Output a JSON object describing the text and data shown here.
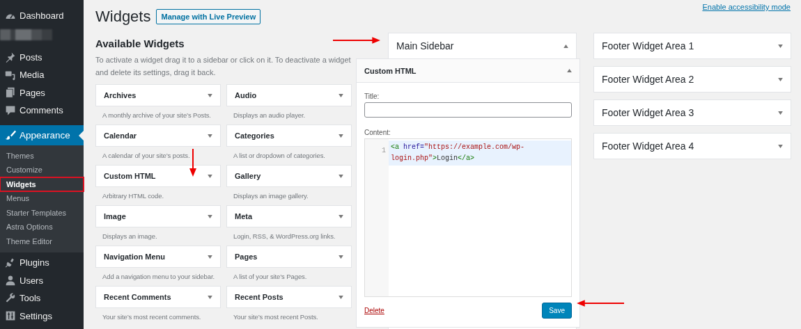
{
  "admin_menu": {
    "items": [
      {
        "kind": "menu",
        "label": "Dashboard",
        "selected": false
      },
      {
        "kind": "redacted"
      },
      {
        "kind": "menu",
        "label": "Posts",
        "selected": false
      },
      {
        "kind": "menu",
        "label": "Media",
        "selected": false
      },
      {
        "kind": "menu",
        "label": "Pages",
        "selected": false
      },
      {
        "kind": "menu",
        "label": "Comments",
        "selected": false
      },
      {
        "kind": "menu",
        "label": "Appearance",
        "selected": true,
        "expanded": true,
        "children": [
          {
            "label": "Themes",
            "selected": false,
            "highlighted": false
          },
          {
            "label": "Customize",
            "selected": false,
            "highlighted": false
          },
          {
            "label": "Widgets",
            "selected": true,
            "highlighted": true
          },
          {
            "label": "Menus",
            "selected": false,
            "highlighted": false
          },
          {
            "label": "Starter Templates",
            "selected": false,
            "highlighted": false
          },
          {
            "label": "Astra Options",
            "selected": false,
            "highlighted": false
          },
          {
            "label": "Theme Editor",
            "selected": false,
            "highlighted": false
          }
        ]
      },
      {
        "kind": "menu",
        "label": "Plugins",
        "selected": false
      },
      {
        "kind": "menu",
        "label": "Users",
        "selected": false
      },
      {
        "kind": "menu",
        "label": "Tools",
        "selected": false
      },
      {
        "kind": "menu",
        "label": "Settings",
        "selected": false
      }
    ]
  },
  "page": {
    "title": "Widgets",
    "live_preview_button": "Manage with Live Preview",
    "accessibility_link": "Enable accessibility mode"
  },
  "available_widgets": {
    "heading": "Available Widgets",
    "description": "To activate a widget drag it to a sidebar or click on it. To deactivate a widget and delete its settings, drag it back.",
    "items": [
      {
        "title": "Archives",
        "description": "A monthly archive of your site’s Posts."
      },
      {
        "title": "Audio",
        "description": "Displays an audio player."
      },
      {
        "title": "Calendar",
        "description": "A calendar of your site’s posts."
      },
      {
        "title": "Categories",
        "description": "A list or dropdown of categories."
      },
      {
        "title": "Custom HTML",
        "description": "Arbitrary HTML code."
      },
      {
        "title": "Gallery",
        "description": "Displays an image gallery."
      },
      {
        "title": "Image",
        "description": "Displays an image."
      },
      {
        "title": "Meta",
        "description": "Login, RSS, & WordPress.org links."
      },
      {
        "title": "Navigation Menu",
        "description": "Add a navigation menu to your sidebar."
      },
      {
        "title": "Pages",
        "description": "A list of your site’s Pages."
      },
      {
        "title": "Recent Comments",
        "description": "Your site’s most recent comments."
      },
      {
        "title": "Recent Posts",
        "description": "Your site’s most recent Posts."
      }
    ]
  },
  "main_sidebar": {
    "title": "Main Sidebar",
    "expanded": true,
    "widget": {
      "title": "Custom HTML",
      "expanded": true,
      "title_label": "Title:",
      "content_label": "Content:",
      "code": {
        "line_number": "1",
        "tokens": [
          {
            "kind": "tag",
            "text": "<a"
          },
          {
            "kind": "attr",
            "text": " href="
          },
          {
            "kind": "string",
            "text": "\"https://example.com/wp-login.php\""
          },
          {
            "kind": "tag",
            "text": ">"
          },
          {
            "kind": "text",
            "text": "Login"
          },
          {
            "kind": "tag",
            "text": "</a>"
          }
        ]
      },
      "delete_link": "Delete",
      "save_button": "Save"
    }
  },
  "footer_areas": [
    {
      "title": "Footer Widget Area 1",
      "expanded": false
    },
    {
      "title": "Footer Widget Area 2",
      "expanded": false
    },
    {
      "title": "Footer Widget Area 3",
      "expanded": false
    },
    {
      "title": "Footer Widget Area 4",
      "expanded": false
    }
  ]
}
